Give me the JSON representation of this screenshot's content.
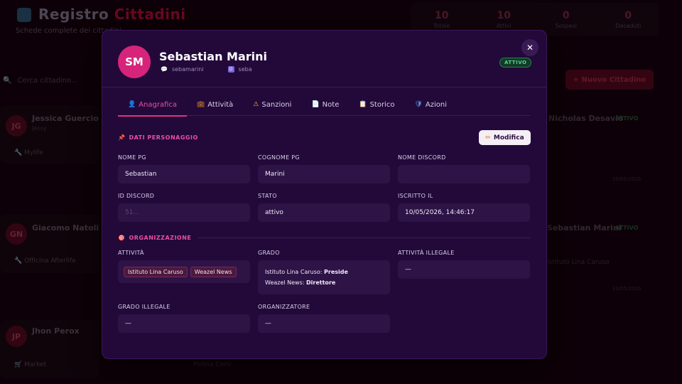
{
  "background": {
    "title_main": "Registro",
    "title_accent": "Cittadini",
    "subtitle": "Schede complete dei cittadini",
    "stats": [
      {
        "value": "10",
        "label": "Totale"
      },
      {
        "value": "10",
        "label": "Attivi"
      },
      {
        "value": "0",
        "label": "Sospesi"
      },
      {
        "value": "0",
        "label": "Deceduti"
      }
    ],
    "search_placeholder": "Cerca cittadino...",
    "new_button": "+ Nuovo Cittadino",
    "cards": [
      {
        "initials": "JG",
        "name": "Jessica Guercio",
        "sub": "Jessy",
        "job": "Mylife"
      },
      {
        "initials": "GN",
        "name": "Giacomo Natoli",
        "sub": "",
        "job": "Officina Afterlife"
      },
      {
        "initials": "JP",
        "name": "Jhon Perox",
        "sub": "",
        "job": "Market"
      }
    ],
    "right_cards": [
      {
        "name": "Nicholas Desavio",
        "badge": "ATTIVO",
        "meta": "20/05/2026"
      },
      {
        "name": "Sebastian Marini",
        "badge": "ATTIVO",
        "job": "Istituto Lina Caruso",
        "meta": "10/05/2026"
      }
    ],
    "bottom_job": "Polizia Corti"
  },
  "modal": {
    "avatar_initials": "SM",
    "name": "Sebastian Marini",
    "meta_handle": "sebamarini",
    "meta_discord": "seba",
    "status_badge": "ATTIVO",
    "close_symbol": "✕",
    "tabs": [
      {
        "icon": "👤",
        "label": "Anagrafica"
      },
      {
        "icon": "💼",
        "label": "Attività"
      },
      {
        "icon": "⚠",
        "label": "Sanzioni"
      },
      {
        "icon": "📄",
        "label": "Note"
      },
      {
        "icon": "📋",
        "label": "Storico"
      },
      {
        "icon": "🛡",
        "label": "Azioni"
      }
    ],
    "section_personaggio": {
      "icon": "📌",
      "label": "DATI PERSONAGGIO"
    },
    "edit_button": {
      "icon": "✏",
      "label": "Modifica"
    },
    "fields": {
      "nome_pg": {
        "label": "NOME PG",
        "value": "Sebastian"
      },
      "cognome_pg": {
        "label": "COGNOME PG",
        "value": "Marini"
      },
      "nome_discord": {
        "label": "NOME DISCORD",
        "value": ""
      },
      "id_discord": {
        "label": "ID DISCORD",
        "value": "51..."
      },
      "stato": {
        "label": "STATO",
        "value": "attivo"
      },
      "iscritto_il": {
        "label": "ISCRITTO IL",
        "value": "10/05/2026, 14:46:17"
      }
    },
    "section_organizzazione": {
      "icon": "🎯",
      "label": "ORGANIZZAZIONE"
    },
    "org": {
      "attivita": {
        "label": "ATTIVITÀ",
        "tags": [
          "Istituto Lina Caruso",
          "Weazel News"
        ]
      },
      "grado": {
        "label": "GRADO",
        "lines": [
          {
            "org": "Istituto Lina Caruso:",
            "role": "Preside"
          },
          {
            "org": "Weazel News:",
            "role": "Direttore"
          }
        ]
      },
      "attivita_illegale": {
        "label": "ATTIVITÀ ILLEGALE",
        "value": "—"
      },
      "grado_illegale": {
        "label": "GRADO ILLEGALE",
        "value": "—"
      },
      "organizzatore": {
        "label": "ORGANIZZATORE",
        "value": "—"
      }
    }
  }
}
